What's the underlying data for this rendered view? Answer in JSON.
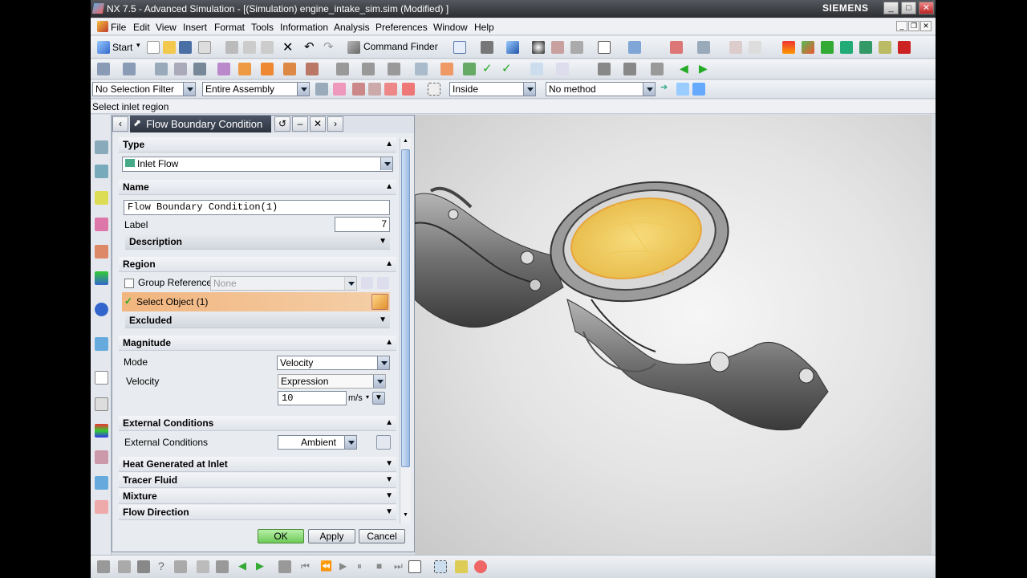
{
  "window": {
    "title": "NX 7.5 - Advanced Simulation - [(Simulation) engine_intake_sim.sim (Modified) ]",
    "brand": "SIEMENS"
  },
  "menu": [
    "File",
    "Edit",
    "View",
    "Insert",
    "Format",
    "Tools",
    "Information",
    "Analysis",
    "Preferences",
    "Window",
    "Help"
  ],
  "toolbar": {
    "start_label": "Start",
    "command_finder_label": "Command Finder"
  },
  "selection_bar": {
    "filter": "No Selection Filter",
    "scope": "Entire Assembly",
    "inside": "Inside",
    "method": "No method"
  },
  "cue_line": "Select inlet region",
  "dialog": {
    "title": "Flow Boundary Condition",
    "type": {
      "header": "Type",
      "value": "Inlet Flow"
    },
    "name": {
      "header": "Name",
      "value": "Flow Boundary Condition(1)",
      "label_caption": "Label",
      "label_value": "7",
      "description_header": "Description"
    },
    "region": {
      "header": "Region",
      "group_reference_label": "Group Reference",
      "group_reference_value": "None",
      "select_object_label": "Select Object (1)",
      "excluded_header": "Excluded"
    },
    "magnitude": {
      "header": "Magnitude",
      "mode_label": "Mode",
      "mode_value": "Velocity",
      "velocity_label": "Velocity",
      "velocity_type": "Expression",
      "velocity_value": "10",
      "velocity_unit": "m/s"
    },
    "external_conditions": {
      "header": "External Conditions",
      "label": "External Conditions",
      "value": "Ambient"
    },
    "collapsed_sections": [
      "Heat Generated at Inlet",
      "Tracer Fluid",
      "Mixture",
      "Flow Direction"
    ],
    "buttons": {
      "ok": "OK",
      "apply": "Apply",
      "cancel": "Cancel"
    }
  },
  "colors": {
    "title_bar": "#2b2d31",
    "dialog_caption": "#3a4352",
    "selected_row": "#f2b57e",
    "ok_button": "#7fd36a",
    "model_gray": "#7a7a7a",
    "highlight_yellow": "#f2cf5a"
  }
}
